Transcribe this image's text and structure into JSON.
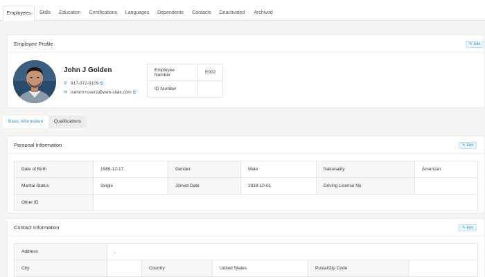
{
  "tabs": [
    {
      "label": "Employees",
      "active": true
    },
    {
      "label": "Skills"
    },
    {
      "label": "Education"
    },
    {
      "label": "Certifications"
    },
    {
      "label": "Languages"
    },
    {
      "label": "Dependents"
    },
    {
      "label": "Contacts"
    },
    {
      "label": "Deactivated"
    },
    {
      "label": "Archived"
    }
  ],
  "profile": {
    "title": "Employee Profile",
    "edit_label": "Edit",
    "name": "John J Golden",
    "phone": "917-372-9109",
    "email": "icehrm+user1@web-stalk.com",
    "employee_number_label": "Employee Number",
    "employee_number": "E002",
    "id_number_label": "ID Number",
    "id_number": ""
  },
  "subtabs": {
    "basic": "Basic Information",
    "qualifications": "Qualifications"
  },
  "personal": {
    "title": "Personal Information",
    "edit_label": "Edit",
    "dob_label": "Date of Birth",
    "dob": "1989-12-17",
    "gender_label": "Gender",
    "gender": "Male",
    "nationality_label": "Nationality",
    "nationality": "American",
    "marital_label": "Marital Status",
    "marital": "Single",
    "joined_label": "Joined Date",
    "joined": "2018-10-01",
    "license_label": "Driving License No",
    "license": "",
    "other_id_label": "Other ID",
    "other_id": ""
  },
  "contact": {
    "title": "Contact Information",
    "edit_label": "Edit",
    "address_label": "Address",
    "address": ",",
    "city_label": "City",
    "city": "",
    "country_label": "Country",
    "country": "United States",
    "postal_label": "Postal/Zip Code",
    "postal": ""
  },
  "colors": {
    "accent": "#2a8fd0",
    "background": "#f4f4f4"
  }
}
